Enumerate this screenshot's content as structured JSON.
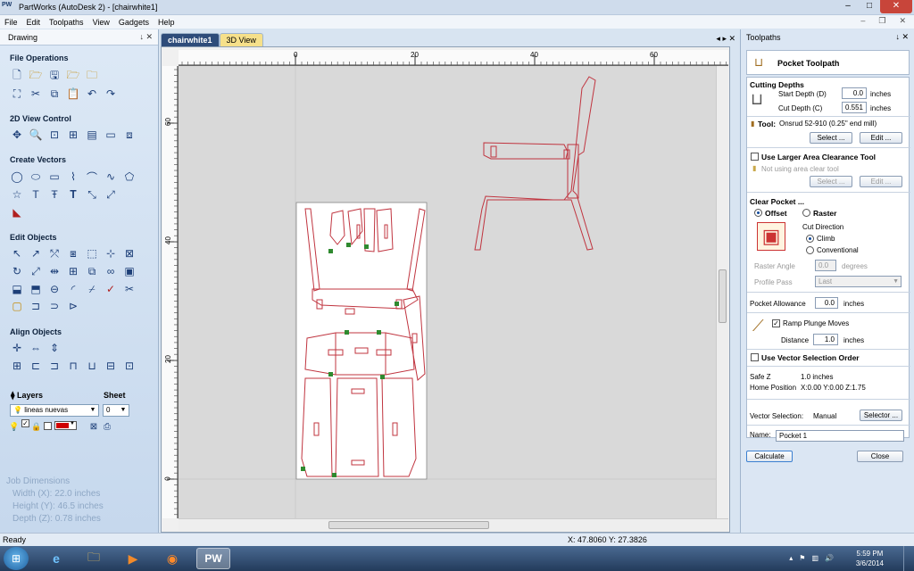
{
  "window": {
    "title": "PartWorks (AutoDesk 2) - [chairwhite1]",
    "app_icon": "PW",
    "min": "–",
    "max": "□",
    "close": "✕"
  },
  "menu": {
    "items": [
      "File",
      "Edit",
      "Toolpaths",
      "View",
      "Gadgets",
      "Help"
    ],
    "mdi_controls": [
      "–",
      "❐",
      "✕"
    ]
  },
  "left_panel": {
    "title": "Drawing",
    "pin": "↓ ✕",
    "sections": {
      "file_ops": "File Operations",
      "view_ctrl": "2D View Control",
      "create_vectors": "Create Vectors",
      "edit_objects": "Edit Objects",
      "align_objects": "Align Objects"
    },
    "layers_label": "Layers",
    "sheet_label": "Sheet",
    "layer_value": "lineas nuevas",
    "sheet_value": "0",
    "job_dims": {
      "title": "Job Dimensions",
      "width": "Width  (X): 22.0 inches",
      "height": "Height (Y): 46.5 inches",
      "depth": "Depth  (Z): 0.78 inches"
    }
  },
  "tabs": {
    "active": "chairwhite1",
    "other": "3D View",
    "controls": "◂ ▸ ✕"
  },
  "rulers": {
    "h_ticks": [
      "0",
      "20",
      "40",
      "60"
    ],
    "v_ticks": [
      "60",
      "40",
      "20",
      "0"
    ]
  },
  "right_panel": {
    "title": "Toolpaths",
    "pin": "↓ ✕",
    "toolpath_title": "Pocket Toolpath",
    "cutting_depths": "Cutting Depths",
    "start_depth_label": "Start Depth (D)",
    "start_depth_value": "0.0",
    "start_depth_unit": "inches",
    "cut_depth_label": "Cut Depth (C)",
    "cut_depth_value": "0.551",
    "cut_depth_unit": "inches",
    "tool_label": "Tool:",
    "tool_value": "Onsrud 52-910 (0.25\" end mill)",
    "select_btn": "Select ...",
    "edit_btn": "Edit ...",
    "use_larger": "Use Larger Area Clearance Tool",
    "not_using": "Not using area clear tool",
    "select_btn2": "Select ...",
    "edit_btn2": "Edit ...",
    "clear_pocket": "Clear Pocket ...",
    "offset": "Offset",
    "raster": "Raster",
    "cut_direction": "Cut Direction",
    "climb": "Climb",
    "conventional": "Conventional",
    "raster_angle_label": "Raster Angle",
    "raster_angle_value": "0.0",
    "raster_angle_unit": "degrees",
    "profile_pass_label": "Profile Pass",
    "profile_pass_value": "Last",
    "pocket_allowance_label": "Pocket Allowance",
    "pocket_allowance_value": "0.0",
    "pocket_allowance_unit": "inches",
    "ramp_label": "Ramp Plunge Moves",
    "distance_label": "Distance",
    "distance_value": "1.0",
    "distance_unit": "inches",
    "use_vector_order": "Use Vector Selection Order",
    "safe_z_label": "Safe Z",
    "safe_z_value": "1.0 inches",
    "home_label": "Home Position",
    "home_value": "X:0.00 Y:0.00 Z:1.75",
    "vector_sel_label": "Vector Selection:",
    "vector_sel_value": "Manual",
    "selector_btn": "Selector ...",
    "name_label": "Name:",
    "name_value": "Pocket 1",
    "calculate_btn": "Calculate",
    "close_btn": "Close"
  },
  "status": {
    "left": "Ready",
    "coords": "X: 47.8060 Y: 27.3826"
  },
  "taskbar": {
    "time": "5:59 PM",
    "date": "3/6/2014",
    "active_app": "PW"
  },
  "colors": {
    "toolpath_red": "#c0343f",
    "selected_node": "#2f8a2f"
  }
}
